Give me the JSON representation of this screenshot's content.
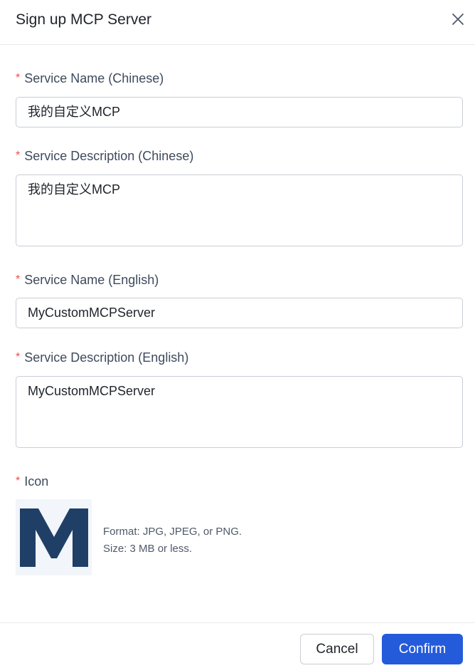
{
  "dialog": {
    "title": "Sign up MCP Server",
    "close_icon": "close-icon"
  },
  "form": {
    "required_mark": "*",
    "name_cn": {
      "label": "Service Name (Chinese)",
      "value": "我的自定义MCP"
    },
    "desc_cn": {
      "label": "Service Description (Chinese)",
      "value": "我的自定义MCP"
    },
    "name_en": {
      "label": "Service Name (English)",
      "value": "MyCustomMCPServer"
    },
    "desc_en": {
      "label": "Service Description (English)",
      "value": "MyCustomMCPServer"
    },
    "icon": {
      "label": "Icon",
      "preview_icon": "letter-m-logo",
      "format_hint": "Format: JPG, JPEG, or PNG.",
      "size_hint": "Size: 3 MB or less."
    }
  },
  "footer": {
    "cancel_label": "Cancel",
    "confirm_label": "Confirm"
  },
  "colors": {
    "primary": "#245bdb",
    "required": "#f54a45",
    "logo_blue": "#1f3f66"
  }
}
